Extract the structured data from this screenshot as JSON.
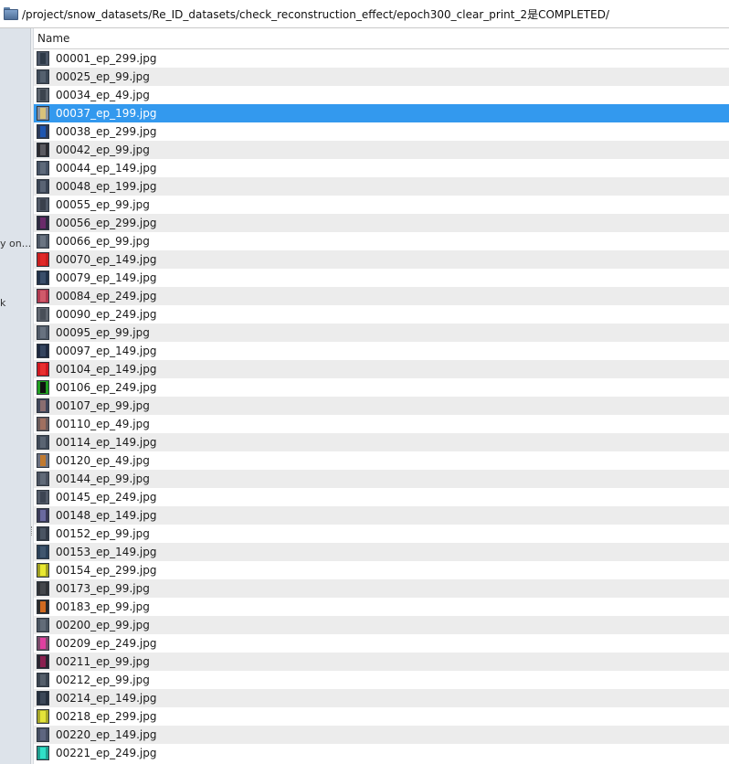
{
  "path_bar": {
    "path": "/project/snow_datasets/Re_ID_datasets/check_reconstruction_effect/epoch300_clear_print_2是COMPLETED/"
  },
  "left_pane": {
    "fragment_1": "y on...",
    "fragment_2": "k"
  },
  "file_list": {
    "column_name": "Name",
    "selected_index": 3,
    "files": [
      {
        "name": "00001_ep_299.jpg",
        "thumb_bg": "#4a5566",
        "thumb_fg": "#2e3a48"
      },
      {
        "name": "00025_ep_99.jpg",
        "thumb_bg": "#3e4a58",
        "thumb_fg": "#55616f"
      },
      {
        "name": "00034_ep_49.jpg",
        "thumb_bg": "#5a626c",
        "thumb_fg": "#3c444e"
      },
      {
        "name": "00037_ep_199.jpg",
        "thumb_bg": "#8a93a0",
        "thumb_fg": "#d8c27a"
      },
      {
        "name": "00038_ep_299.jpg",
        "thumb_bg": "#2a3a5a",
        "thumb_fg": "#1e56b0"
      },
      {
        "name": "00042_ep_99.jpg",
        "thumb_bg": "#2c2c30",
        "thumb_fg": "#5a5a60"
      },
      {
        "name": "00044_ep_149.jpg",
        "thumb_bg": "#465264",
        "thumb_fg": "#5e6a7a"
      },
      {
        "name": "00048_ep_199.jpg",
        "thumb_bg": "#3a4454",
        "thumb_fg": "#5a6474"
      },
      {
        "name": "00055_ep_99.jpg",
        "thumb_bg": "#505866",
        "thumb_fg": "#3a404c"
      },
      {
        "name": "00056_ep_299.jpg",
        "thumb_bg": "#2e2a40",
        "thumb_fg": "#6a2a6a"
      },
      {
        "name": "00066_ep_99.jpg",
        "thumb_bg": "#4e5866",
        "thumb_fg": "#6a7482"
      },
      {
        "name": "00070_ep_149.jpg",
        "thumb_bg": "#c81e1e",
        "thumb_fg": "#e02828"
      },
      {
        "name": "00079_ep_149.jpg",
        "thumb_bg": "#22324a",
        "thumb_fg": "#3a4e6a"
      },
      {
        "name": "00084_ep_249.jpg",
        "thumb_bg": "#b03a50",
        "thumb_fg": "#d05a6a"
      },
      {
        "name": "00090_ep_249.jpg",
        "thumb_bg": "#606670",
        "thumb_fg": "#484e58"
      },
      {
        "name": "00095_ep_99.jpg",
        "thumb_bg": "#505a68",
        "thumb_fg": "#687280"
      },
      {
        "name": "00097_ep_149.jpg",
        "thumb_bg": "#1e2a40",
        "thumb_fg": "#34445e"
      },
      {
        "name": "00104_ep_149.jpg",
        "thumb_bg": "#d01820",
        "thumb_fg": "#e83030"
      },
      {
        "name": "00106_ep_249.jpg",
        "thumb_bg": "#20a020",
        "thumb_fg": "#101010"
      },
      {
        "name": "00107_ep_99.jpg",
        "thumb_bg": "#40465a",
        "thumb_fg": "#8a6e70"
      },
      {
        "name": "00110_ep_49.jpg",
        "thumb_bg": "#6a5a5a",
        "thumb_fg": "#a07060"
      },
      {
        "name": "00114_ep_149.jpg",
        "thumb_bg": "#404a58",
        "thumb_fg": "#5a6472"
      },
      {
        "name": "00120_ep_49.jpg",
        "thumb_bg": "#6a7080",
        "thumb_fg": "#c07a30"
      },
      {
        "name": "00144_ep_99.jpg",
        "thumb_bg": "#4a5260",
        "thumb_fg": "#606a78"
      },
      {
        "name": "00145_ep_249.jpg",
        "thumb_bg": "#525a68",
        "thumb_fg": "#3c4452"
      },
      {
        "name": "00148_ep_149.jpg",
        "thumb_bg": "#3a3a58",
        "thumb_fg": "#6a6aa0"
      },
      {
        "name": "00152_ep_99.jpg",
        "thumb_bg": "#323a46",
        "thumb_fg": "#4a5462"
      },
      {
        "name": "00153_ep_149.jpg",
        "thumb_bg": "#2a4058",
        "thumb_fg": "#40566e"
      },
      {
        "name": "00154_ep_299.jpg",
        "thumb_bg": "#a0a020",
        "thumb_fg": "#e8e830"
      },
      {
        "name": "00173_ep_99.jpg",
        "thumb_bg": "#303236",
        "thumb_fg": "#44474c"
      },
      {
        "name": "00183_ep_99.jpg",
        "thumb_bg": "#2a2a2a",
        "thumb_fg": "#d06a20"
      },
      {
        "name": "00200_ep_99.jpg",
        "thumb_bg": "#4a5460",
        "thumb_fg": "#626c78"
      },
      {
        "name": "00209_ep_249.jpg",
        "thumb_bg": "#7a4a6a",
        "thumb_fg": "#e040a0"
      },
      {
        "name": "00211_ep_99.jpg",
        "thumb_bg": "#2a2430",
        "thumb_fg": "#8a2050"
      },
      {
        "name": "00212_ep_99.jpg",
        "thumb_bg": "#3a4450",
        "thumb_fg": "#545e6a"
      },
      {
        "name": "00214_ep_149.jpg",
        "thumb_bg": "#26303e",
        "thumb_fg": "#3c4858"
      },
      {
        "name": "00218_ep_299.jpg",
        "thumb_bg": "#a8a828",
        "thumb_fg": "#e4e43a"
      },
      {
        "name": "00220_ep_149.jpg",
        "thumb_bg": "#464e62",
        "thumb_fg": "#5e6680"
      },
      {
        "name": "00221_ep_249.jpg",
        "thumb_bg": "#20a090",
        "thumb_fg": "#30e0c8"
      }
    ]
  }
}
